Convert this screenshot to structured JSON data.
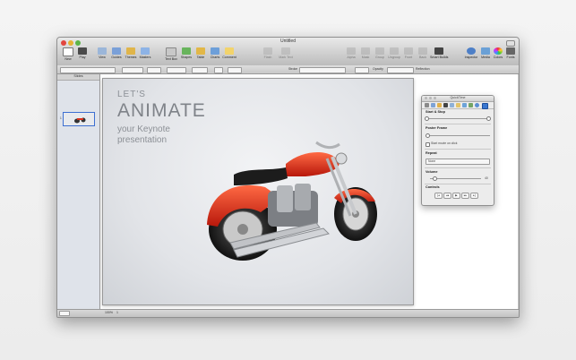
{
  "window": {
    "title": "Untitled"
  },
  "toolbar": {
    "left": [
      {
        "label": "New",
        "icon": "new-slide-icon"
      },
      {
        "label": "Play",
        "icon": "play-icon"
      },
      {
        "label": "View",
        "icon": "view-icon"
      },
      {
        "label": "Guides",
        "icon": "guides-icon"
      },
      {
        "label": "Themes",
        "icon": "themes-icon"
      },
      {
        "label": "Masters",
        "icon": "masters-icon"
      },
      {
        "label": "Text Box",
        "icon": "text-box-icon"
      },
      {
        "label": "Shapes",
        "icon": "shapes-icon"
      },
      {
        "label": "Table",
        "icon": "table-icon"
      },
      {
        "label": "Charts",
        "icon": "charts-icon"
      },
      {
        "label": "Comment",
        "icon": "comment-icon"
      }
    ],
    "right": [
      {
        "label": "Alpha",
        "icon": "alpha-icon"
      },
      {
        "label": "Mask",
        "icon": "mask-icon"
      },
      {
        "label": "Group",
        "icon": "group-icon"
      },
      {
        "label": "Ungroup",
        "icon": "ungroup-icon"
      },
      {
        "label": "Front",
        "icon": "front-icon"
      },
      {
        "label": "Back",
        "icon": "back-icon"
      },
      {
        "label": "Smart Builds",
        "icon": "smart-builds-icon"
      },
      {
        "label": "Inspector",
        "icon": "inspector-icon"
      },
      {
        "label": "Media",
        "icon": "media-icon"
      },
      {
        "label": "Colors",
        "icon": "colors-icon"
      },
      {
        "label": "Fonts",
        "icon": "fonts-icon"
      }
    ],
    "middle_dim": [
      "Flash",
      "Mark Text"
    ]
  },
  "formatbar": {
    "zoom_text": "Stroke",
    "opacity_text": "Opacity",
    "reflection_text": "Reflection"
  },
  "sidebar": {
    "header": "Slides",
    "slide_number": "1"
  },
  "slide": {
    "line1": "LET'S",
    "line2": "ANIMATE",
    "line3": "your Keynote",
    "line4": "presentation",
    "colors": {
      "text": "#8a8e94",
      "moto_red": "#e5361d"
    }
  },
  "statusbar": {
    "zoom": "100%",
    "page": "1"
  },
  "quicktime": {
    "title": "QuickTime",
    "start_stop": "Start & Stop",
    "poster_frame": "Poster Frame",
    "start_on_click": "Start movie on click",
    "repeat": "Repeat",
    "repeat_value": "None",
    "volume": "Volume",
    "volume_max": "40",
    "controls": "Controls",
    "buttons": [
      "|◂",
      "◂◂",
      "▶",
      "▸▸",
      "▸|"
    ]
  }
}
